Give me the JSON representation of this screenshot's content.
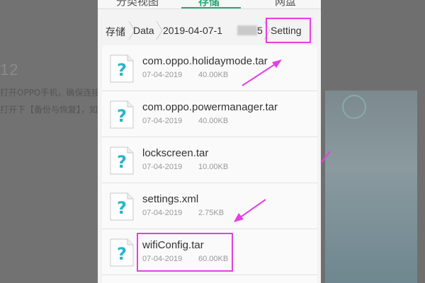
{
  "background": {
    "title": "12",
    "lines": [
      "打开OPPO手机，确保连接",
      "打开下【备份与恢复】，如"
    ]
  },
  "tabs": [
    {
      "label": "分类视图"
    },
    {
      "label": "存储"
    },
    {
      "label": "网盘"
    }
  ],
  "breadcrumb": {
    "root": "存储",
    "data": "Data",
    "backup": "2019-04-07-1",
    "backup_tail": "5",
    "current": "Setting"
  },
  "files": [
    {
      "name": "com.oppo.holidaymode.tar",
      "date": "07-04-2019",
      "size": "40.00KB",
      "icon": "unknown-file-icon"
    },
    {
      "name": "com.oppo.powermanager.tar",
      "date": "07-04-2019",
      "size": "40.00KB",
      "icon": "unknown-file-icon"
    },
    {
      "name": "lockscreen.tar",
      "date": "07-04-2019",
      "size": "10.00KB",
      "icon": "unknown-file-icon"
    },
    {
      "name": "settings.xml",
      "date": "07-04-2019",
      "size": "2.75KB",
      "icon": "unknown-file-icon"
    },
    {
      "name": "wifiConfig.tar",
      "date": "07-04-2019",
      "size": "60.00KB",
      "icon": "unknown-file-icon"
    }
  ],
  "colors": {
    "accent": "#2aa77a",
    "annotation": "#e63ee6",
    "icon_question": "#2bb4c9"
  }
}
